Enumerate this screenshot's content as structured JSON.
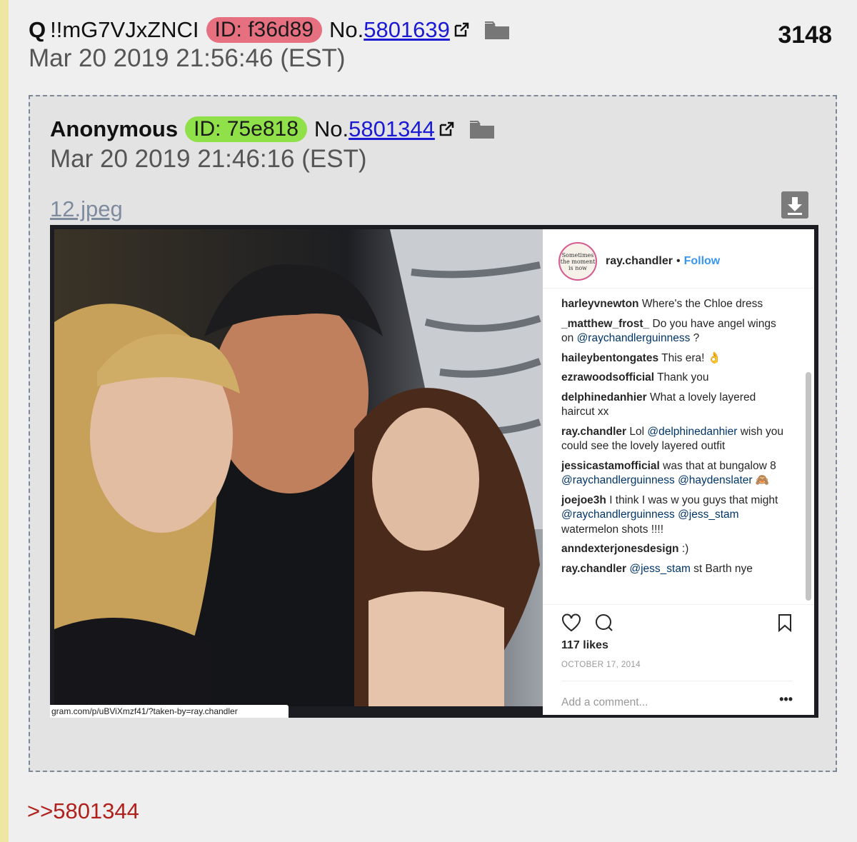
{
  "post": {
    "name": "Q",
    "tripcode": "!!mG7VJxZNCI",
    "id_label": "ID: f36d89",
    "no_prefix": "No.",
    "no": "5801639",
    "date": "Mar 20 2019 21:56:46 (EST)",
    "count": "3148",
    "reply_link": ">>5801344",
    "colors": {
      "id_badge": "#e66f80",
      "reply_link": "#b0211c"
    }
  },
  "quoted": {
    "name": "Anonymous",
    "id_label": "ID: 75e818",
    "no_prefix": "No.",
    "no": "5801344",
    "date": "Mar 20 2019 21:46:16 (EST)",
    "filename": "12.jpeg",
    "colors": {
      "id_badge": "#90e04a"
    }
  },
  "image": {
    "url_caption": "gram.com/p/uBViXmzf41/?taken-by=ray.chandler",
    "instagram": {
      "avatar_text": "Sometimes the moment is now",
      "user": "ray.chandler",
      "dot": "•",
      "follow": "Follow",
      "comments": [
        {
          "user": "harleyvnewton",
          "text": " Where's the Chloe dress"
        },
        {
          "user": "_matthew_frost_",
          "text": " Do you have angel wings on ",
          "mention": "@raychandlerguinness",
          "after": " ?"
        },
        {
          "user": "haileybentongates",
          "text": " This era! 👌"
        },
        {
          "user": "ezrawoodsofficial",
          "text": " Thank you"
        },
        {
          "user": "delphinedanhier",
          "text": " What a lovely layered haircut xx"
        },
        {
          "user": "ray.chandler",
          "text": " Lol ",
          "mention": "@delphinedanhier",
          "after": " wish you could see the lovely layered outfit"
        },
        {
          "user": "jessicastamofficial",
          "text": " was that at bungalow 8 ",
          "mention": "@raychandlerguinness @haydenslater",
          "after": " 🙈"
        },
        {
          "user": "joejoe3h",
          "text": " I think I was w you guys that might ",
          "mention": "@raychandlerguinness @jess_stam",
          "after": " watermelon shots !!!!"
        },
        {
          "user": "anndexterjonesdesign",
          "text": " :)"
        },
        {
          "user": "ray.chandler",
          "text": " ",
          "mention": "@jess_stam",
          "after": " st Barth nye"
        }
      ],
      "likes": "117 likes",
      "date": "OCTOBER 17, 2014",
      "add_comment": "Add a comment...",
      "more": "•••",
      "icons": [
        "heart-icon",
        "comment-icon",
        "bookmark-icon"
      ]
    }
  }
}
